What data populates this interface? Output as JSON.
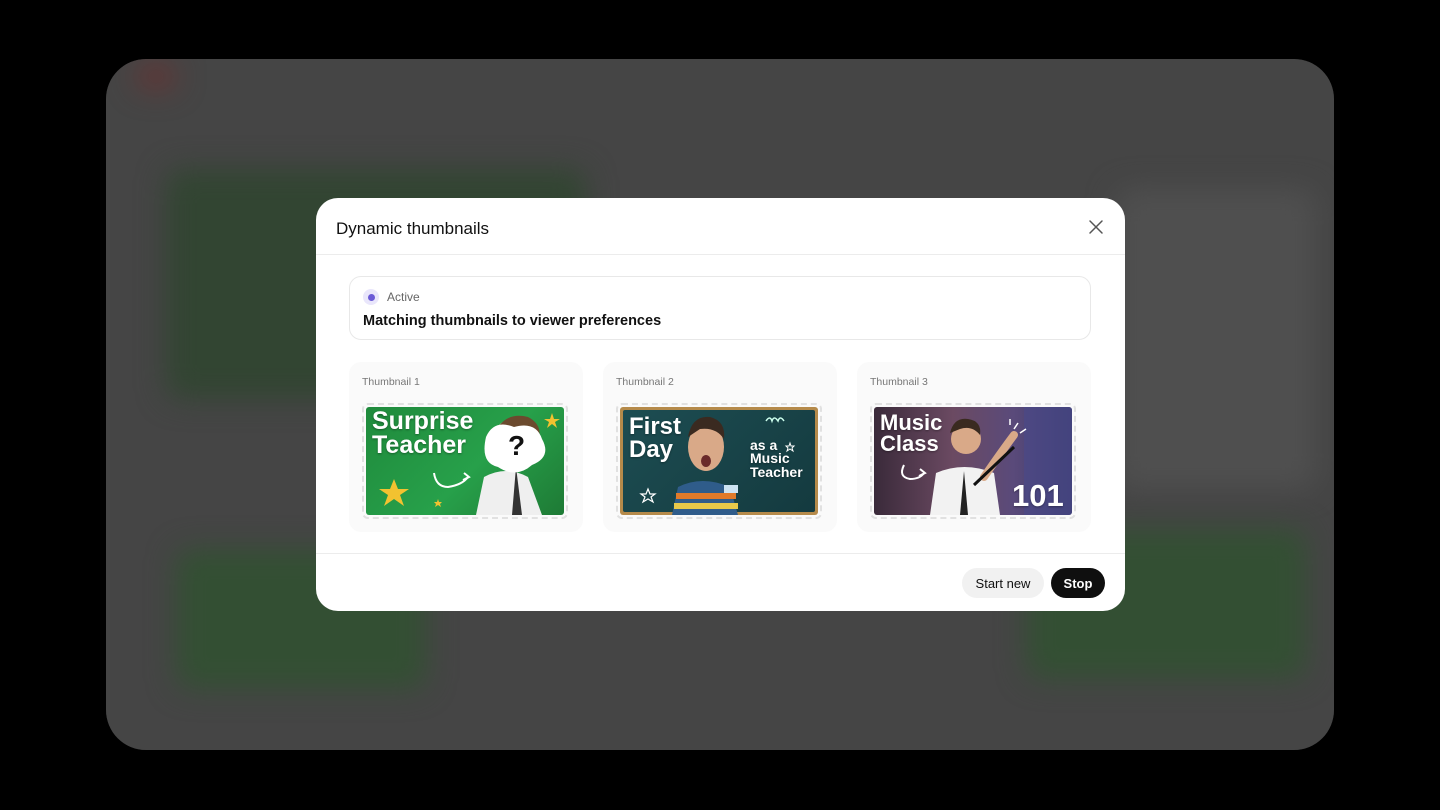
{
  "modal": {
    "title": "Dynamic thumbnails"
  },
  "status": {
    "label": "Active",
    "text": "Matching thumbnails to viewer preferences"
  },
  "thumbnails": [
    {
      "label": "Thumbnail 1",
      "title": "Surprise\nTeacher",
      "extra": "?"
    },
    {
      "label": "Thumbnail 2",
      "title": "First\nDay",
      "subtitle": "as a\nMusic\nTeacher"
    },
    {
      "label": "Thumbnail 3",
      "title": "Music\nClass",
      "extra": "101"
    }
  ],
  "footer": {
    "start_new_label": "Start new",
    "stop_label": "Stop"
  },
  "colors": {
    "accent": "#6b5bd6",
    "primary_button": "#0f0f0f"
  }
}
